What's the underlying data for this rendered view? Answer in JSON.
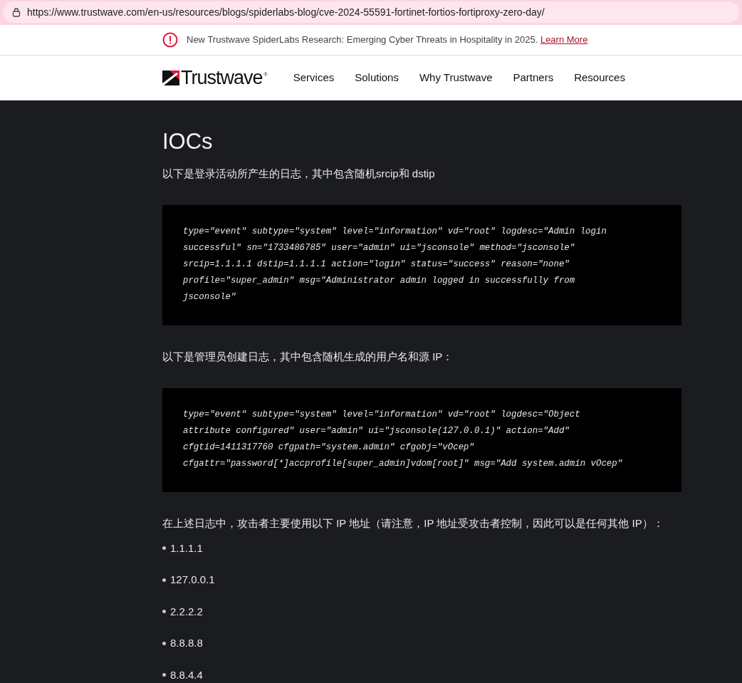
{
  "address_bar": {
    "url": "https://www.trustwave.com/en-us/resources/blogs/spiderlabs-blog/cve-2024-55591-fortinet-fortios-fortiproxy-zero-day/"
  },
  "banner": {
    "text": "New Trustwave SpiderLabs Research: Emerging Cyber Threats in Hospitality in 2025.",
    "link": "Learn More"
  },
  "nav": {
    "logo": "Trustwave",
    "logo_mark": "®",
    "items": [
      "Services",
      "Solutions",
      "Why Trustwave",
      "Partners",
      "Resources"
    ]
  },
  "article": {
    "heading": "IOCs",
    "blocks": [
      {
        "kind": "paragraph",
        "text": "以下是登录活动所产生的日志，其中包含随机srcip和 dstip"
      },
      {
        "kind": "code",
        "lines": [
          "type=\"event\" subtype=\"system\" level=\"information\" vd=\"root\" logdesc=\"Admin login",
          "successful\" sn=\"1733486785\" user=\"admin\" ui=\"jsconsole\" method=\"jsconsole\"",
          "srcip=1.1.1.1 dstip=1.1.1.1 action=\"login\" status=\"success\" reason=\"none\"",
          "profile=\"super_admin\" msg=\"Administrator admin logged in successfully from",
          "jsconsole\""
        ]
      },
      {
        "kind": "paragraph",
        "text": "以下是管理员创建日志，其中包含随机生成的用户名和源 IP："
      },
      {
        "kind": "code",
        "lines": [
          "type=\"event\" subtype=\"system\" level=\"information\" vd=\"root\" logdesc=\"Object",
          "attribute configured\" user=\"admin\" ui=\"jsconsole(127.0.0.1)\" action=\"Add\"",
          "cfgtid=1411317760 cfgpath=\"system.admin\" cfgobj=\"vOcep\"",
          "cfgattr=\"password[*]accprofile[super_admin]vdom[root]\" msg=\"Add system.admin vOcep\""
        ]
      },
      {
        "kind": "paragraph",
        "text": "在上述日志中，攻击者主要使用以下 IP 地址（请注意，IP 地址受攻击者控制，因此可以是任何其他 IP）："
      },
      {
        "kind": "list",
        "items": [
          "1.1.1.1",
          "127.0.0.1",
          "2.2.2.2",
          "8.8.8.8",
          "8.8.4.4"
        ]
      }
    ]
  }
}
